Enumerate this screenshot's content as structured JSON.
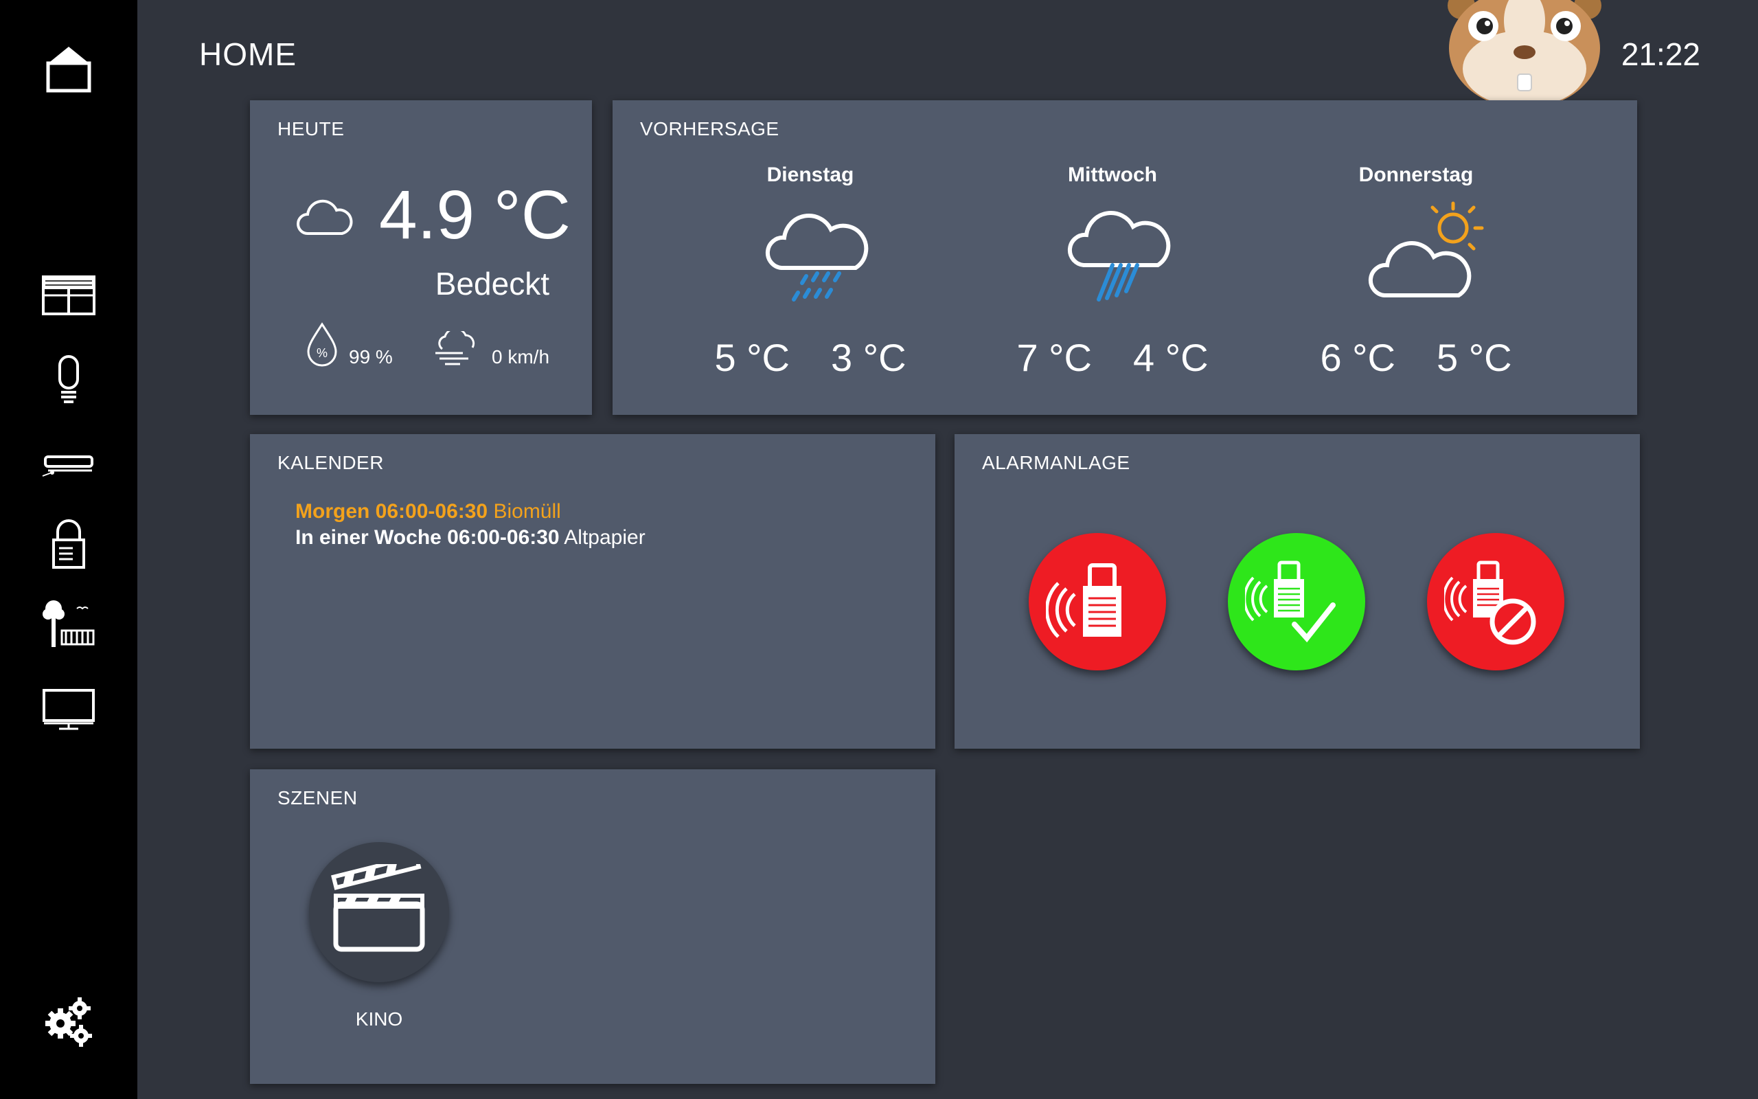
{
  "header": {
    "title": "HOME",
    "clock": "21:22"
  },
  "sidebar": {
    "items": [
      {
        "icon": "home-icon"
      },
      {
        "icon": "window-icon"
      },
      {
        "icon": "light-bulb-icon"
      },
      {
        "icon": "robot-vacuum-icon"
      },
      {
        "icon": "lock-icon"
      },
      {
        "icon": "garden-icon"
      },
      {
        "icon": "monitor-icon"
      },
      {
        "icon": "gear-icon"
      }
    ]
  },
  "today": {
    "title": "HEUTE",
    "temperature": "4.9 °C",
    "condition": "Bedeckt",
    "humidity": "99 %",
    "wind": "0 km/h"
  },
  "forecast": {
    "title": "VORHERSAGE",
    "days": [
      {
        "name": "Dienstag",
        "high": "5 °C",
        "low": "3 °C",
        "icon": "drizzle-icon"
      },
      {
        "name": "Mittwoch",
        "high": "7 °C",
        "low": "4 °C",
        "icon": "rain-icon"
      },
      {
        "name": "Donnerstag",
        "high": "6 °C",
        "low": "5 °C",
        "icon": "partly-cloudy-icon"
      }
    ]
  },
  "calendar": {
    "title": "KALENDER",
    "entries": [
      {
        "when": "Morgen 06:00-06:30",
        "what": "Biomüll"
      },
      {
        "when": "In einer Woche 06:00-06:30",
        "what": "Altpapier"
      }
    ]
  },
  "alarm": {
    "title": "ALARMANLAGE",
    "buttons": [
      {
        "state": "armed",
        "color": "#ee1c24"
      },
      {
        "state": "ok",
        "color": "#2ee61a"
      },
      {
        "state": "disabled",
        "color": "#ee1c24"
      }
    ]
  },
  "scenes": {
    "title": "SZENEN",
    "items": [
      {
        "label": "KINO",
        "icon": "clapperboard-icon"
      }
    ]
  },
  "colors": {
    "background": "#30343d",
    "card": "#515a6b",
    "accent": "#f3a21c",
    "rain": "#2b8cd6"
  }
}
